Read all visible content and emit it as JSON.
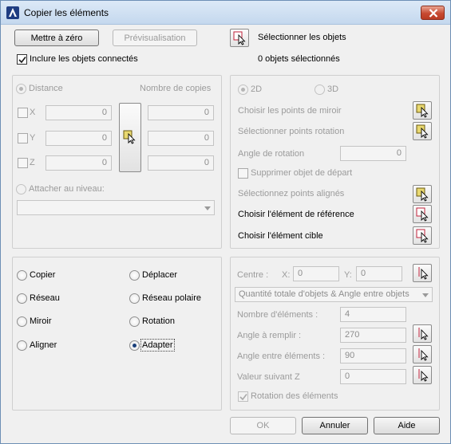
{
  "window": {
    "title": "Copier les éléments",
    "close_icon": "close-icon",
    "app_icon": "autocad-logo-icon"
  },
  "toolbar": {
    "reset_label": "Mettre à zéro",
    "preview_label": "Prévisualisation",
    "select_objects_label": "Sélectionner les objets",
    "selected_count_text": "0 objets sélectionnés",
    "include_connected_label": "Inclure les objets connectés",
    "include_connected_checked": true
  },
  "distance_panel": {
    "distance_label": "Distance",
    "copies_label": "Nombre de copies",
    "axes": [
      {
        "label": "X",
        "value": "0",
        "copies": "0"
      },
      {
        "label": "Y",
        "value": "0",
        "copies": "0"
      },
      {
        "label": "Z",
        "value": "0",
        "copies": "0"
      }
    ],
    "attach_level_label": "Attacher au niveau:",
    "attach_level_value": ""
  },
  "mirror_panel": {
    "mode_2d": "2D",
    "mode_3d": "3D",
    "mirror_points_label": "Choisir les points de miroir",
    "rotation_points_label": "Sélectionner points rotation",
    "rotation_angle_label": "Angle de rotation",
    "rotation_angle_value": "0",
    "delete_source_label": "Supprimer objet de départ",
    "aligned_points_label": "Sélectionnez points alignés",
    "reference_label": "Choisir l'élément de référence",
    "target_label": "Choisir l'élément cible"
  },
  "operations": {
    "items": [
      {
        "label": "Copier",
        "selected": false
      },
      {
        "label": "Déplacer",
        "selected": false
      },
      {
        "label": "Réseau",
        "selected": false
      },
      {
        "label": "Réseau polaire",
        "selected": false
      },
      {
        "label": "Miroir",
        "selected": false
      },
      {
        "label": "Rotation",
        "selected": false
      },
      {
        "label": "Aligner",
        "selected": false
      },
      {
        "label": "Adapter",
        "selected": true
      }
    ]
  },
  "polar_panel": {
    "center_label": "Centre :",
    "x_label": "X:",
    "x_value": "0",
    "y_label": "Y:",
    "y_value": "0",
    "mode_value": "Quantité totale d'objets & Angle entre objets",
    "count_label": "Nombre d'éléments :",
    "count_value": "4",
    "fill_angle_label": "Angle à remplir :",
    "fill_angle_value": "270",
    "between_angle_label": "Angle entre éléments :",
    "between_angle_value": "90",
    "z_value_label": "Valeur suivant Z",
    "z_value": "0",
    "rotate_items_label": "Rotation des éléments",
    "rotate_items_checked": true
  },
  "footer": {
    "ok_label": "OK",
    "cancel_label": "Annuler",
    "help_label": "Aide"
  }
}
